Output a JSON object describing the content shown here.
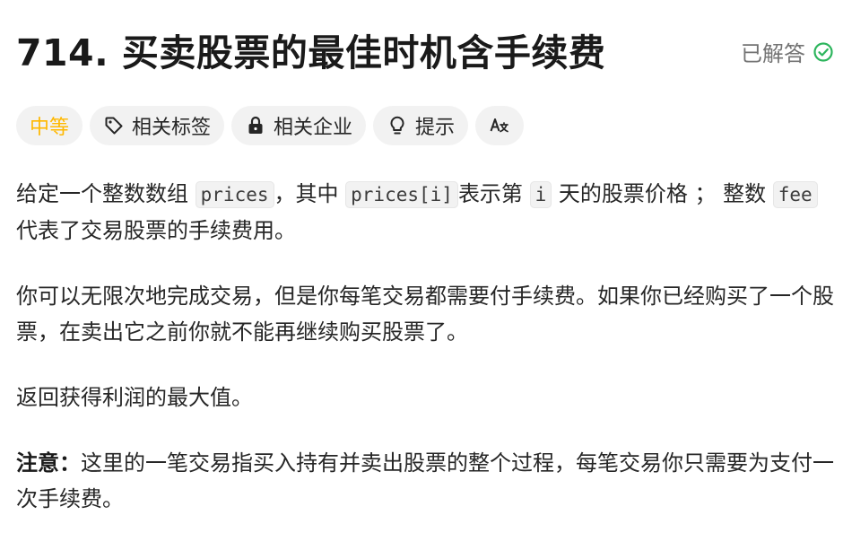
{
  "problem": {
    "title": "714. 买卖股票的最佳时机含手续费",
    "status_label": "已解答",
    "status_color": "#2db55d"
  },
  "tags": [
    {
      "label": "中等",
      "icon": "",
      "color": "#ffb800"
    },
    {
      "label": "相关标签",
      "icon": "tag-icon"
    },
    {
      "label": "相关企业",
      "icon": "lock-icon"
    },
    {
      "label": "提示",
      "icon": "lightbulb-icon"
    },
    {
      "label": "",
      "icon": "translate-icon"
    }
  ],
  "description": {
    "p1_a": "给定一个整数数组 ",
    "p1_code1": "prices",
    "p1_b": "，其中 ",
    "p1_code2": "prices[i]",
    "p1_c": "表示第 ",
    "p1_code3": "i",
    "p1_d": " 天的股票价格 ； 整数 ",
    "p1_code4": "fee",
    "p1_e": " 代表了交易股票的手续费用。",
    "p2": "你可以无限次地完成交易，但是你每笔交易都需要付手续费。如果你已经购买了一个股票，在卖出它之前你就不能再继续购买股票了。",
    "p3": "返回获得利润的最大值。",
    "p4_bold": "注意：",
    "p4_text": "这里的一笔交易指买入持有并卖出股票的整个过程，每笔交易你只需要为支付一次手续费。"
  }
}
